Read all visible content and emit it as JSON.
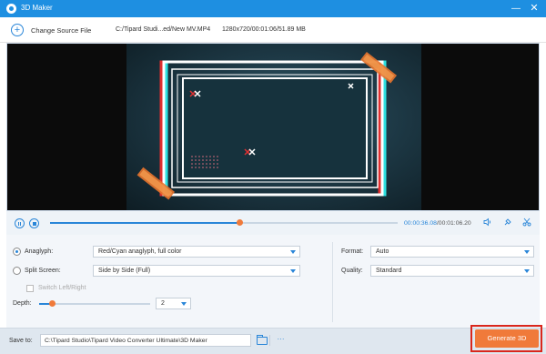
{
  "window": {
    "title": "3D Maker",
    "minimize": "—",
    "close": "✕"
  },
  "toolbar": {
    "change_source": "Change Source File",
    "file_path": "C:/Tipard Studi...ed/New MV.MP4",
    "file_meta": "1280x720/00:01:06/51.89 MB"
  },
  "player": {
    "current_time": "00:00:36.08",
    "total_time": "/00:01:06.20",
    "progress_fraction": 0.545
  },
  "settings": {
    "anaglyph_label": "Anaglyph:",
    "anaglyph_value": "Red/Cyan anaglyph, full color",
    "split_label": "Split Screen:",
    "split_value": "Side by Side (Full)",
    "switch_label": "Switch Left/Right",
    "depth_label": "Depth:",
    "depth_value": "2",
    "depth_fraction": 0.12,
    "format_label": "Format:",
    "format_value": "Auto",
    "quality_label": "Quality:",
    "quality_value": "Standard"
  },
  "save": {
    "label": "Save to:",
    "path": "C:\\Tipard Studio\\Tipard Video Converter Ultimate\\3D Maker",
    "browse": "···",
    "generate": "Generate 3D"
  },
  "colors": {
    "accent": "#2a86d8",
    "titlebar": "#1e8fe1",
    "generate": "#f07a3a",
    "highlight": "#d9261c"
  }
}
